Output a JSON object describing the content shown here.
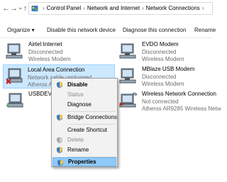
{
  "address_bar": {
    "back": "←",
    "forward": "→",
    "dropdown": "⌄",
    "up": "↑",
    "crumbs": [
      "Control Panel",
      "Network and Internet",
      "Network Connections"
    ],
    "separator": "›"
  },
  "toolbar": {
    "organize": "Organize ▾",
    "disable": "Disable this network device",
    "diagnose": "Diagnose this connection",
    "rename": "Rename"
  },
  "connections": [
    {
      "name": "Airtel Internet",
      "status": "Disconnected",
      "device": "Wireless Modem",
      "icon": "modem-icon"
    },
    {
      "name": "EVDO Modem",
      "status": "Disconnected",
      "device": "Wireless Modem",
      "icon": "modem-icon"
    },
    {
      "name": "Local Area Connection",
      "status": "Network cable unplugged",
      "device": "Atheros A",
      "icon": "ethernet-disconnected-icon"
    },
    {
      "name": "MBlaze USB Modem",
      "status": "Disconnected",
      "device": "Wireless Modem",
      "icon": "modem-icon"
    },
    {
      "name": "USBDEVIC",
      "status": "",
      "device": "",
      "icon": "ethernet-icon"
    },
    {
      "name": "Wireless Network Connection",
      "status": "Not connected",
      "device": "Atheros AR9285 Wireless Netw",
      "icon": "wireless-icon"
    }
  ],
  "context_menu": {
    "disable": "Disable",
    "status": "Status",
    "diagnose": "Diagnose",
    "bridge": "Bridge Connections",
    "shortcut": "Create Shortcut",
    "delete": "Delete",
    "rename": "Rename",
    "properties": "Properties"
  },
  "colors": {
    "selection_bg": "#cce8ff",
    "menu_highlight": "#91c9f7",
    "secondary_text": "#6d6d6d"
  }
}
